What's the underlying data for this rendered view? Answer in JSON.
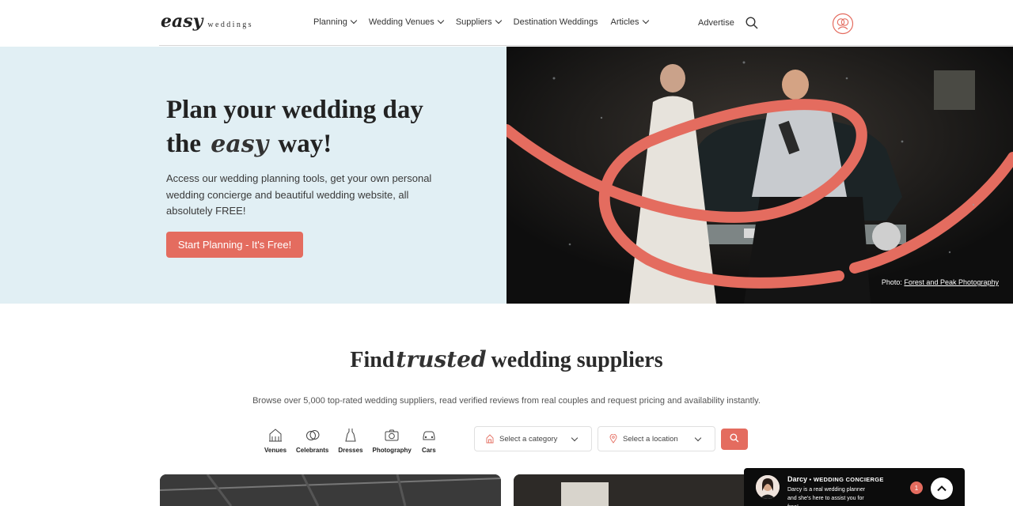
{
  "header": {
    "logo_script": "easy",
    "logo_word": "weddings",
    "nav": [
      {
        "label": "Planning"
      },
      {
        "label": "Wedding Venues"
      },
      {
        "label": "Suppliers"
      },
      {
        "label": "Destination Weddings"
      },
      {
        "label": "Articles"
      }
    ],
    "advertise": "Advertise",
    "icons": {
      "search": "search-icon",
      "account": "user-account-icon"
    }
  },
  "hero": {
    "title_line1": "Plan your wedding day",
    "title_the": "the",
    "title_easy": "easy",
    "title_way": "way!",
    "description": "Access our wedding planning tools, get your own personal wedding concierge and beautiful wedding website, all absolutely FREE!",
    "cta": "Start Planning - It's Free!",
    "photo_credit_prefix": "Photo:",
    "photo_credit_link": "Forest and Peak Photography"
  },
  "suppliers": {
    "title_find": "Find",
    "title_trusted": "trusted",
    "title_rest": "wedding suppliers",
    "subtitle": "Browse over 5,000 top-rated wedding suppliers, read verified reviews from real couples and request pricing and availability instantly.",
    "categories": [
      {
        "label": "Venues",
        "icon": "venue-icon"
      },
      {
        "label": "Celebrants",
        "icon": "rings-icon"
      },
      {
        "label": "Dresses",
        "icon": "dress-icon"
      },
      {
        "label": "Photography",
        "icon": "camera-icon"
      },
      {
        "label": "Cars",
        "icon": "car-icon"
      }
    ],
    "category_select": "Select a category",
    "location_select": "Select a location"
  },
  "concierge": {
    "name": "Darcy",
    "role": "WEDDING CONCIERGE",
    "description": "Darcy is a real wedding planner and she's here to assist you for free!",
    "badge": "1"
  },
  "colors": {
    "accent": "#e46c5f",
    "hero_bg": "#e1eff4"
  }
}
